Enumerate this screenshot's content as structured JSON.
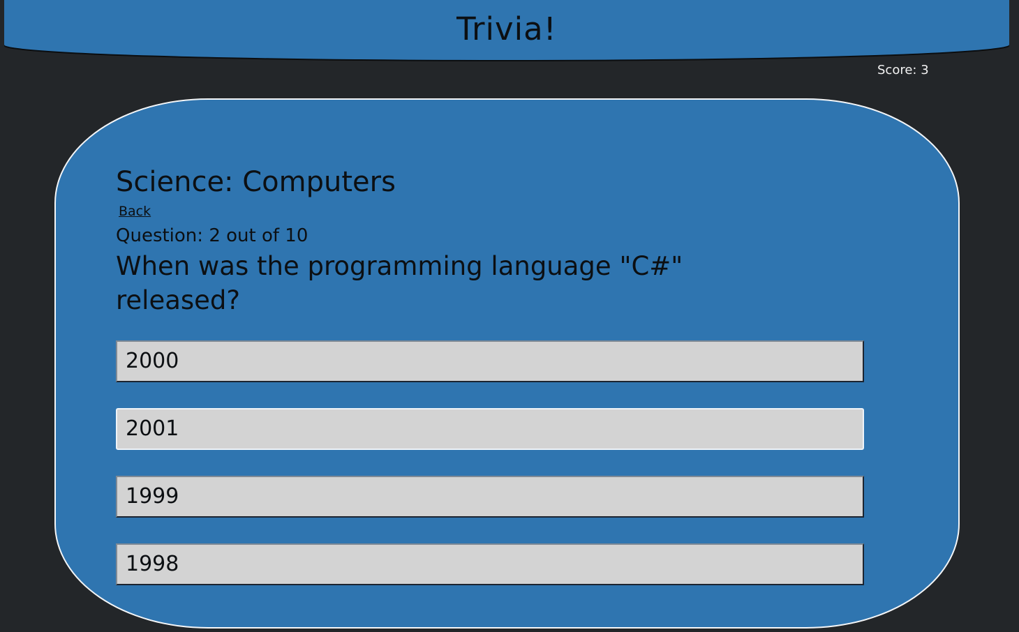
{
  "header": {
    "title": "Trivia!"
  },
  "score_text": "Score: 3",
  "quiz": {
    "category": "Science: Computers",
    "back_label": "Back",
    "counter": "Question: 2 out of 10",
    "question": "When was the programming language \"C#\" released?",
    "answers": [
      "2000",
      "2001",
      "1999",
      "1998"
    ]
  },
  "colors": {
    "background": "#232629",
    "panel": "#2f75b0",
    "answer_fill": "#d3d3d3",
    "text": "#0c0f12"
  }
}
